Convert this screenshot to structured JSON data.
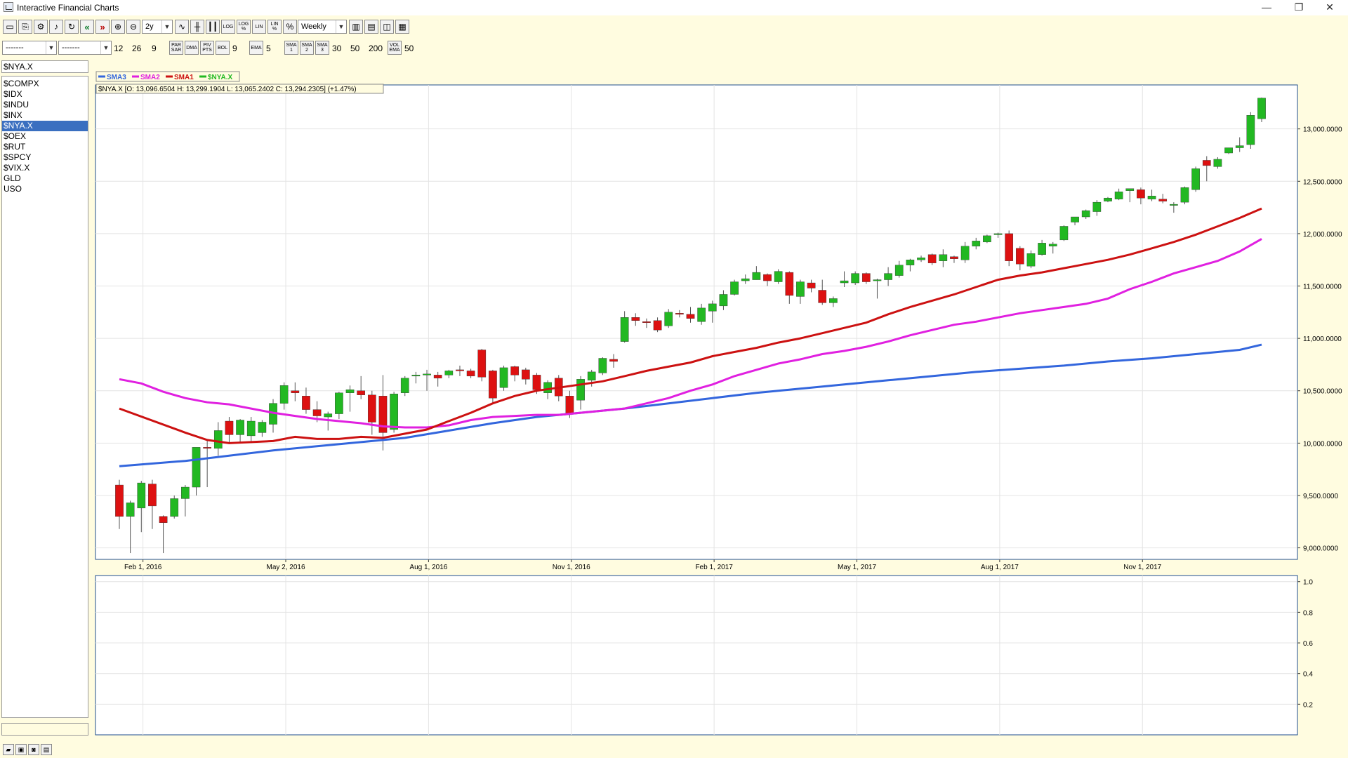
{
  "window": {
    "title": "Interactive Financial Charts",
    "minimize_glyph": "—",
    "restore_glyph": "❐",
    "close_glyph": "✕"
  },
  "toolbar1": {
    "period_value": "2y",
    "frequency_value": "Weekly",
    "left_buttons": [
      {
        "icon": "print-icon",
        "text": "▭"
      },
      {
        "icon": "copy-icon",
        "text": "⎘"
      },
      {
        "icon": "settings-icon",
        "text": "⚙"
      },
      {
        "icon": "speaker-icon",
        "text": "♪"
      },
      {
        "icon": "refresh-icon",
        "text": "↻"
      },
      {
        "icon": "scroll-left-icon",
        "text": "«"
      },
      {
        "icon": "scroll-right-icon",
        "text": "»"
      },
      {
        "icon": "zoom-in-icon",
        "text": "⊕"
      },
      {
        "icon": "zoom-out-icon",
        "text": "⊖"
      }
    ],
    "mid_buttons": [
      {
        "icon": "line-chart-icon",
        "text": "∿"
      },
      {
        "icon": "ohlc-bar-icon",
        "text": "╫"
      },
      {
        "icon": "candlestick-icon",
        "text": "┃┃"
      },
      {
        "icon": "log-scale-icon",
        "text": "LOG"
      },
      {
        "icon": "log-pct-icon",
        "text": "LOG %"
      },
      {
        "icon": "lin-scale-icon",
        "text": "LIN"
      },
      {
        "icon": "lin-pct-icon",
        "text": "LIN %"
      },
      {
        "icon": "percent-icon",
        "text": "%"
      }
    ],
    "right_buttons": [
      {
        "icon": "indicator-panel-icon",
        "text": "▥"
      },
      {
        "icon": "chart-window-icon",
        "text": "▤"
      },
      {
        "icon": "compare-chart-icon",
        "text": "◫"
      },
      {
        "icon": "table-view-icon",
        "text": "▦"
      }
    ]
  },
  "toolbar2": {
    "combo1": "-------",
    "combo2": "-------",
    "macd_fast": "12",
    "macd_slow": "26",
    "macd_signal": "9",
    "btn_psar": "PAR SAR",
    "btn_dma": "DMA",
    "btn_pivot": "PIV PTS",
    "btn_bol": "BOL",
    "bol_period": "9",
    "btn_ema": "EMA",
    "ema_period": "5",
    "btn_sma1": "SMA 1",
    "btn_sma2": "SMA 2",
    "btn_sma3": "SMA 3",
    "sma1_period": "30",
    "sma2_period": "50",
    "sma3_period": "200",
    "btn_volema": "VOL EMA",
    "volema_period": "50"
  },
  "sidebar": {
    "symbol_input": "$NYA.X",
    "symbols": [
      "$COMPX",
      "$IDX",
      "$INDU",
      "$INX",
      "$NYA.X",
      "$OEX",
      "$RUT",
      "$SPCY",
      "$VIX.X",
      "GLD",
      "USO"
    ],
    "selected": "$NYA.X"
  },
  "colors": {
    "background": "#FFFCE0",
    "up_candle": "#22B822",
    "down_candle": "#DD1111",
    "sma1": "#CC1111",
    "sma2": "#E020E0",
    "sma3": "#3366DD",
    "selection": "#3A6FC0"
  },
  "chart_data": {
    "type": "candlestick",
    "symbol": "$NYA.X",
    "frequency": "Weekly",
    "quote_line": "$NYA.X [O: 13,096.6504  H: 13,299.1904  L: 13,065.2402  C: 13,294.2305] (+1.47%)",
    "legend": [
      {
        "name": "SMA3",
        "color": "#3366DD"
      },
      {
        "name": "SMA2",
        "color": "#E020E0"
      },
      {
        "name": "SMA1",
        "color": "#CC1111"
      },
      {
        "name": "$NYA.X",
        "color": "#22B822"
      }
    ],
    "x_tick_labels": [
      "Feb 1, 2016",
      "May 2, 2016",
      "Aug 1, 2016",
      "Nov 1, 2016",
      "Feb 1, 2017",
      "May 1, 2017",
      "Aug 1, 2017",
      "Nov 1, 2017"
    ],
    "x_tick_weeks": [
      2,
      15,
      28,
      41,
      54,
      67,
      80,
      93
    ],
    "y_tick_labels": [
      "13,000.0000",
      "12,500.0000",
      "12,000.0000",
      "11,500.0000",
      "11,000.0000",
      "10,500.0000",
      "10,000.0000",
      "9,500.0000",
      "9,000.0000"
    ],
    "y_tick_values": [
      13000,
      12500,
      12000,
      11500,
      11000,
      10500,
      10000,
      9500,
      9000
    ],
    "ylim": [
      8890,
      13420
    ],
    "candles": [
      [
        9600,
        9650,
        9180,
        9300
      ],
      [
        9300,
        9450,
        8950,
        9430
      ],
      [
        9380,
        9640,
        9150,
        9620
      ],
      [
        9610,
        9650,
        9180,
        9400
      ],
      [
        9300,
        9310,
        8950,
        9240
      ],
      [
        9300,
        9500,
        9280,
        9470
      ],
      [
        9470,
        9600,
        9300,
        9580
      ],
      [
        9580,
        9620,
        9500,
        9960
      ],
      [
        9960,
        10020,
        9580,
        9950
      ],
      [
        9950,
        10200,
        9880,
        10120
      ],
      [
        10210,
        10250,
        10000,
        10080
      ],
      [
        10080,
        10230,
        10000,
        10220
      ],
      [
        10070,
        10250,
        10000,
        10210
      ],
      [
        10100,
        10220,
        10060,
        10200
      ],
      [
        10180,
        10420,
        10100,
        10380
      ],
      [
        10380,
        10580,
        10320,
        10550
      ],
      [
        10500,
        10580,
        10400,
        10480
      ],
      [
        10450,
        10530,
        10280,
        10320
      ],
      [
        10320,
        10400,
        10200,
        10260
      ],
      [
        10250,
        10300,
        10120,
        10280
      ],
      [
        10280,
        10490,
        10230,
        10480
      ],
      [
        10480,
        10550,
        10300,
        10510
      ],
      [
        10500,
        10640,
        10420,
        10460
      ],
      [
        10460,
        10500,
        10080,
        10200
      ],
      [
        10450,
        10650,
        9930,
        10100
      ],
      [
        10130,
        10490,
        10100,
        10470
      ],
      [
        10480,
        10640,
        10450,
        10620
      ],
      [
        10640,
        10680,
        10570,
        10650
      ],
      [
        10650,
        10700,
        10500,
        10660
      ],
      [
        10650,
        10680,
        10540,
        10620
      ],
      [
        10650,
        10700,
        10620,
        10690
      ],
      [
        10700,
        10740,
        10640,
        10690
      ],
      [
        10690,
        10710,
        10620,
        10640
      ],
      [
        10890,
        10900,
        10590,
        10630
      ],
      [
        10690,
        10700,
        10380,
        10430
      ],
      [
        10530,
        10740,
        10500,
        10720
      ],
      [
        10730,
        10740,
        10590,
        10650
      ],
      [
        10700,
        10720,
        10560,
        10610
      ],
      [
        10650,
        10670,
        10470,
        10510
      ],
      [
        10480,
        10600,
        10420,
        10580
      ],
      [
        10620,
        10650,
        10400,
        10450
      ],
      [
        10450,
        10500,
        10240,
        10280
      ],
      [
        10410,
        10640,
        10320,
        10610
      ],
      [
        10600,
        10700,
        10540,
        10680
      ],
      [
        10670,
        10820,
        10650,
        10810
      ],
      [
        10800,
        10850,
        10720,
        10780
      ],
      [
        10970,
        11260,
        10960,
        11200
      ],
      [
        11200,
        11240,
        11120,
        11170
      ],
      [
        11160,
        11190,
        11100,
        11150
      ],
      [
        11170,
        11200,
        11060,
        11080
      ],
      [
        11120,
        11280,
        11100,
        11250
      ],
      [
        11240,
        11270,
        11200,
        11230
      ],
      [
        11230,
        11300,
        11150,
        11190
      ],
      [
        11160,
        11330,
        11130,
        11290
      ],
      [
        11260,
        11360,
        11150,
        11330
      ],
      [
        11310,
        11460,
        11270,
        11420
      ],
      [
        11420,
        11560,
        11410,
        11540
      ],
      [
        11550,
        11610,
        11520,
        11570
      ],
      [
        11560,
        11690,
        11560,
        11630
      ],
      [
        11610,
        11620,
        11500,
        11550
      ],
      [
        11540,
        11660,
        11520,
        11640
      ],
      [
        11630,
        11640,
        11330,
        11410
      ],
      [
        11400,
        11560,
        11330,
        11540
      ],
      [
        11530,
        11560,
        11440,
        11480
      ],
      [
        11460,
        11560,
        11320,
        11340
      ],
      [
        11340,
        11400,
        11300,
        11380
      ],
      [
        11530,
        11640,
        11490,
        11550
      ],
      [
        11530,
        11640,
        11510,
        11620
      ],
      [
        11620,
        11630,
        11520,
        11540
      ],
      [
        11560,
        11570,
        11380,
        11560
      ],
      [
        11560,
        11680,
        11500,
        11620
      ],
      [
        11600,
        11740,
        11580,
        11700
      ],
      [
        11700,
        11760,
        11640,
        11750
      ],
      [
        11750,
        11790,
        11730,
        11770
      ],
      [
        11800,
        11810,
        11700,
        11720
      ],
      [
        11740,
        11850,
        11680,
        11800
      ],
      [
        11780,
        11790,
        11720,
        11760
      ],
      [
        11750,
        11920,
        11720,
        11880
      ],
      [
        11880,
        11960,
        11850,
        11930
      ],
      [
        11920,
        11990,
        11910,
        11980
      ],
      [
        11990,
        12010,
        11960,
        12000
      ],
      [
        12000,
        12030,
        11690,
        11740
      ],
      [
        11860,
        11880,
        11650,
        11710
      ],
      [
        11690,
        11840,
        11670,
        11810
      ],
      [
        11800,
        11940,
        11790,
        11910
      ],
      [
        11880,
        11920,
        11810,
        11900
      ],
      [
        11940,
        12080,
        11930,
        12070
      ],
      [
        12110,
        12160,
        12080,
        12160
      ],
      [
        12160,
        12230,
        12140,
        12220
      ],
      [
        12210,
        12320,
        12170,
        12300
      ],
      [
        12310,
        12350,
        12300,
        12340
      ],
      [
        12330,
        12430,
        12320,
        12400
      ],
      [
        12410,
        12420,
        12300,
        12430
      ],
      [
        12420,
        12440,
        12280,
        12340
      ],
      [
        12330,
        12420,
        12310,
        12360
      ],
      [
        12330,
        12380,
        12290,
        12310
      ],
      [
        12270,
        12300,
        12200,
        12280
      ],
      [
        12300,
        12450,
        12280,
        12440
      ],
      [
        12420,
        12640,
        12400,
        12620
      ],
      [
        12700,
        12740,
        12500,
        12650
      ],
      [
        12640,
        12730,
        12620,
        12710
      ],
      [
        12770,
        12820,
        12760,
        12820
      ],
      [
        12820,
        12920,
        12780,
        12840
      ],
      [
        12850,
        13160,
        12810,
        13130
      ],
      [
        13097,
        13299,
        13065,
        13294
      ]
    ],
    "sma1": [
      [
        0,
        10330
      ],
      [
        6,
        10100
      ],
      [
        8,
        10030
      ],
      [
        10,
        10000
      ],
      [
        12,
        10010
      ],
      [
        14,
        10020
      ],
      [
        16,
        10060
      ],
      [
        18,
        10040
      ],
      [
        20,
        10040
      ],
      [
        22,
        10060
      ],
      [
        24,
        10050
      ],
      [
        26,
        10090
      ],
      [
        28,
        10130
      ],
      [
        30,
        10210
      ],
      [
        32,
        10290
      ],
      [
        34,
        10380
      ],
      [
        36,
        10450
      ],
      [
        38,
        10500
      ],
      [
        40,
        10530
      ],
      [
        42,
        10560
      ],
      [
        44,
        10590
      ],
      [
        46,
        10640
      ],
      [
        48,
        10690
      ],
      [
        50,
        10730
      ],
      [
        52,
        10770
      ],
      [
        54,
        10830
      ],
      [
        56,
        10870
      ],
      [
        58,
        10910
      ],
      [
        60,
        10960
      ],
      [
        62,
        11000
      ],
      [
        64,
        11050
      ],
      [
        66,
        11100
      ],
      [
        68,
        11150
      ],
      [
        70,
        11230
      ],
      [
        72,
        11300
      ],
      [
        74,
        11360
      ],
      [
        76,
        11420
      ],
      [
        78,
        11490
      ],
      [
        80,
        11560
      ],
      [
        82,
        11600
      ],
      [
        84,
        11630
      ],
      [
        86,
        11670
      ],
      [
        88,
        11710
      ],
      [
        90,
        11750
      ],
      [
        92,
        11800
      ],
      [
        94,
        11860
      ],
      [
        96,
        11920
      ],
      [
        98,
        11990
      ],
      [
        100,
        12070
      ],
      [
        102,
        12150
      ],
      [
        104,
        12240
      ]
    ],
    "sma2": [
      [
        0,
        10610
      ],
      [
        2,
        10570
      ],
      [
        4,
        10490
      ],
      [
        6,
        10430
      ],
      [
        8,
        10390
      ],
      [
        10,
        10370
      ],
      [
        12,
        10330
      ],
      [
        14,
        10290
      ],
      [
        16,
        10260
      ],
      [
        18,
        10230
      ],
      [
        20,
        10210
      ],
      [
        22,
        10190
      ],
      [
        24,
        10160
      ],
      [
        26,
        10150
      ],
      [
        28,
        10150
      ],
      [
        30,
        10170
      ],
      [
        32,
        10220
      ],
      [
        34,
        10250
      ],
      [
        36,
        10260
      ],
      [
        38,
        10270
      ],
      [
        40,
        10270
      ],
      [
        42,
        10290
      ],
      [
        44,
        10310
      ],
      [
        46,
        10330
      ],
      [
        48,
        10380
      ],
      [
        50,
        10430
      ],
      [
        52,
        10500
      ],
      [
        54,
        10560
      ],
      [
        56,
        10640
      ],
      [
        58,
        10700
      ],
      [
        60,
        10760
      ],
      [
        62,
        10800
      ],
      [
        64,
        10850
      ],
      [
        66,
        10880
      ],
      [
        68,
        10920
      ],
      [
        70,
        10970
      ],
      [
        72,
        11030
      ],
      [
        74,
        11080
      ],
      [
        76,
        11130
      ],
      [
        78,
        11160
      ],
      [
        80,
        11200
      ],
      [
        82,
        11240
      ],
      [
        84,
        11270
      ],
      [
        86,
        11300
      ],
      [
        88,
        11330
      ],
      [
        90,
        11380
      ],
      [
        92,
        11470
      ],
      [
        94,
        11540
      ],
      [
        96,
        11620
      ],
      [
        98,
        11680
      ],
      [
        100,
        11740
      ],
      [
        102,
        11830
      ],
      [
        104,
        11950
      ]
    ],
    "sma3": [
      [
        0,
        9780
      ],
      [
        6,
        9830
      ],
      [
        10,
        9880
      ],
      [
        14,
        9930
      ],
      [
        18,
        9970
      ],
      [
        22,
        10010
      ],
      [
        26,
        10050
      ],
      [
        30,
        10120
      ],
      [
        34,
        10190
      ],
      [
        38,
        10250
      ],
      [
        42,
        10290
      ],
      [
        46,
        10330
      ],
      [
        50,
        10380
      ],
      [
        54,
        10430
      ],
      [
        58,
        10480
      ],
      [
        62,
        10520
      ],
      [
        66,
        10560
      ],
      [
        70,
        10600
      ],
      [
        74,
        10640
      ],
      [
        78,
        10680
      ],
      [
        82,
        10710
      ],
      [
        86,
        10740
      ],
      [
        90,
        10780
      ],
      [
        94,
        10810
      ],
      [
        98,
        10850
      ],
      [
        102,
        10890
      ],
      [
        104,
        10940
      ]
    ],
    "lower_panel_y_ticks": [
      "1.0",
      "0.8",
      "0.6",
      "0.4",
      "0.2"
    ],
    "lower_panel_y_values": [
      1.0,
      0.8,
      0.6,
      0.4,
      0.2
    ],
    "lower_panel_ylim": [
      0,
      1.04
    ]
  }
}
